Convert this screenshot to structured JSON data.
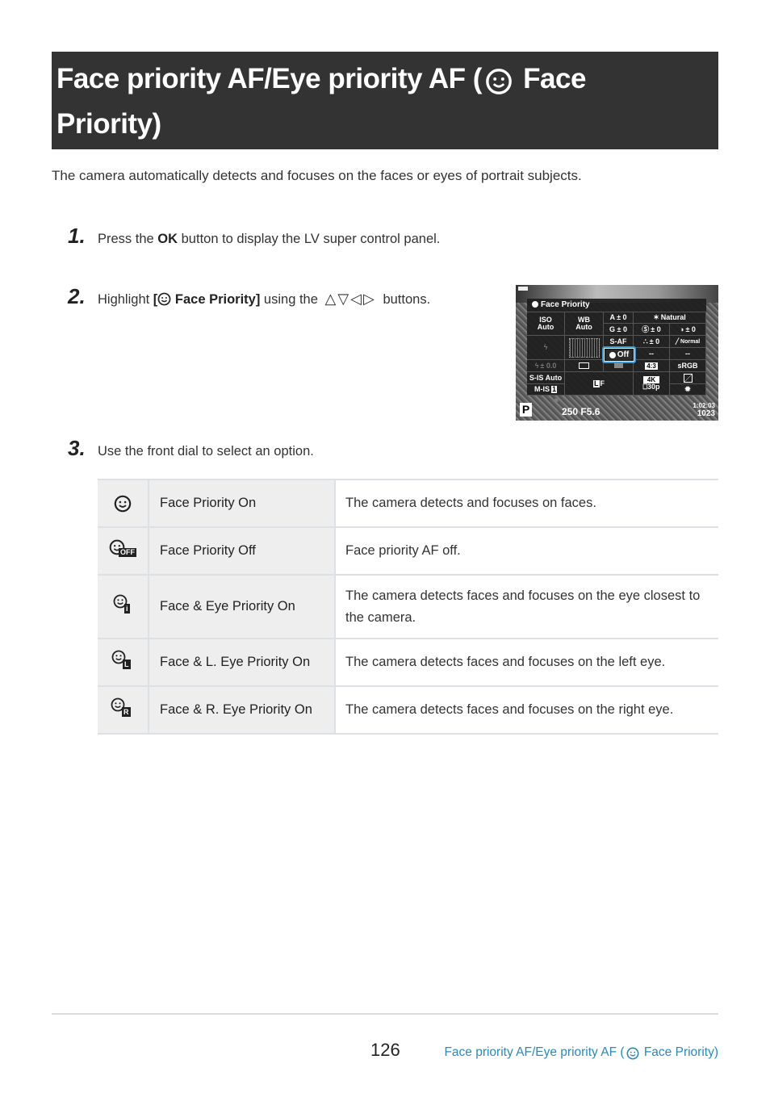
{
  "header": {
    "title_part1": "Face priority AF/Eye priority AF (",
    "title_icon": "face-icon",
    "title_part2": " Face",
    "title_line2": "Priority)"
  },
  "intro": "The camera automatically detects and focuses on the faces or eyes of portrait subjects.",
  "steps": [
    {
      "number": "1.",
      "text_before": "Press the ",
      "bold": "OK",
      "text_after": " button to display the LV super control panel."
    },
    {
      "number": "2.",
      "text_before": "Highlight ",
      "bold_open": "[",
      "icon": "face-icon",
      "bold": " Face Priority]",
      "text_middle": " using the ",
      "arrows": "△▽◁▷",
      "text_after": " buttons."
    },
    {
      "number": "3.",
      "text": "Use the front dial to select an option."
    }
  ],
  "camera_screen": {
    "panel_title": "Face Priority",
    "cells": {
      "iso": "ISO\nAuto",
      "wb": "WB\nAuto",
      "a": "A ± 0",
      "g": "G ± 0",
      "picture_mode": "Natural",
      "sharpness": "± 0",
      "contrast": "± 0",
      "saturation": "± 0",
      "gradation": "Normal",
      "af_mode": "S-AF",
      "dash1": "--",
      "dash2": "--",
      "flash_comp": "± 0.0",
      "aspect": "4:3",
      "color_space": "sRGB",
      "s_is": "S-IS Auto",
      "m_is": "M-IS",
      "m_is_num": "1",
      "quality": "F",
      "video_res": "4K",
      "video_fps": "30p",
      "selected": "Off"
    },
    "mode": "P",
    "shutter": "250",
    "aperture": "F5.6",
    "time": "1:02:03",
    "shots": "1023"
  },
  "options_table": {
    "rows": [
      {
        "icon": "face-priority-on-icon",
        "badge": "",
        "name": "Face Priority On",
        "description": "The camera detects and focuses on faces."
      },
      {
        "icon": "face-priority-off-icon",
        "badge": "OFF",
        "name": "Face Priority Off",
        "description": "Face priority AF off."
      },
      {
        "icon": "face-eye-priority-icon",
        "badge": "i",
        "name": "Face & Eye Priority On",
        "description": "The camera detects faces and focuses on the eye closest to the camera."
      },
      {
        "icon": "face-left-eye-priority-icon",
        "badge": "L",
        "name": "Face & L. Eye Priority On",
        "description": "The camera detects faces and focuses on the left eye."
      },
      {
        "icon": "face-right-eye-priority-icon",
        "badge": "R",
        "name": "Face & R. Eye Priority On",
        "description": "The camera detects faces and focuses on the right eye."
      }
    ]
  },
  "footer": {
    "page_number": "126",
    "link_part1": "Face priority AF/Eye priority AF (",
    "link_part2": " Face Priority)",
    "link_color": "#2a8ab8"
  }
}
